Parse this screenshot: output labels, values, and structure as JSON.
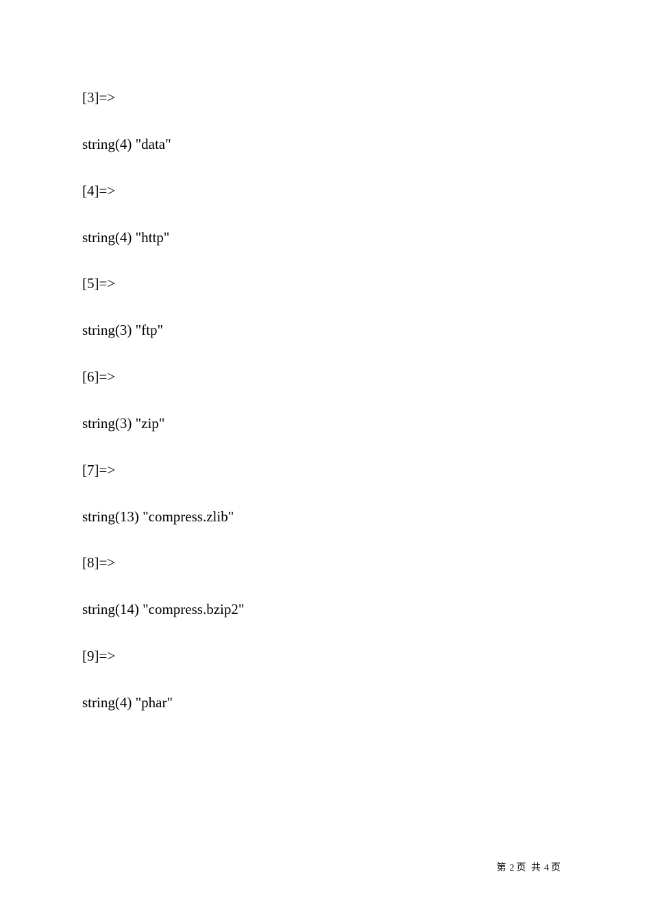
{
  "lines": {
    "l0": "[3]=>",
    "l1": "string(4) \"data\"",
    "l2": "[4]=>",
    "l3": "string(4) \"http\"",
    "l4": "[5]=>",
    "l5": "string(3) \"ftp\"",
    "l6": "[6]=>",
    "l7": "string(3) \"zip\"",
    "l8": "[7]=>",
    "l9": "string(13) \"compress.zlib\"",
    "l10": "[8]=>",
    "l11": "string(14) \"compress.bzip2\"",
    "l12": "[9]=>",
    "l13": "string(4) \"phar\""
  },
  "footer": {
    "text_full": "第 2 页 共 4 页",
    "prefix": "第",
    "page_current": "2",
    "mid1": "页",
    "mid2": "共",
    "page_total": "4",
    "suffix": "页"
  }
}
